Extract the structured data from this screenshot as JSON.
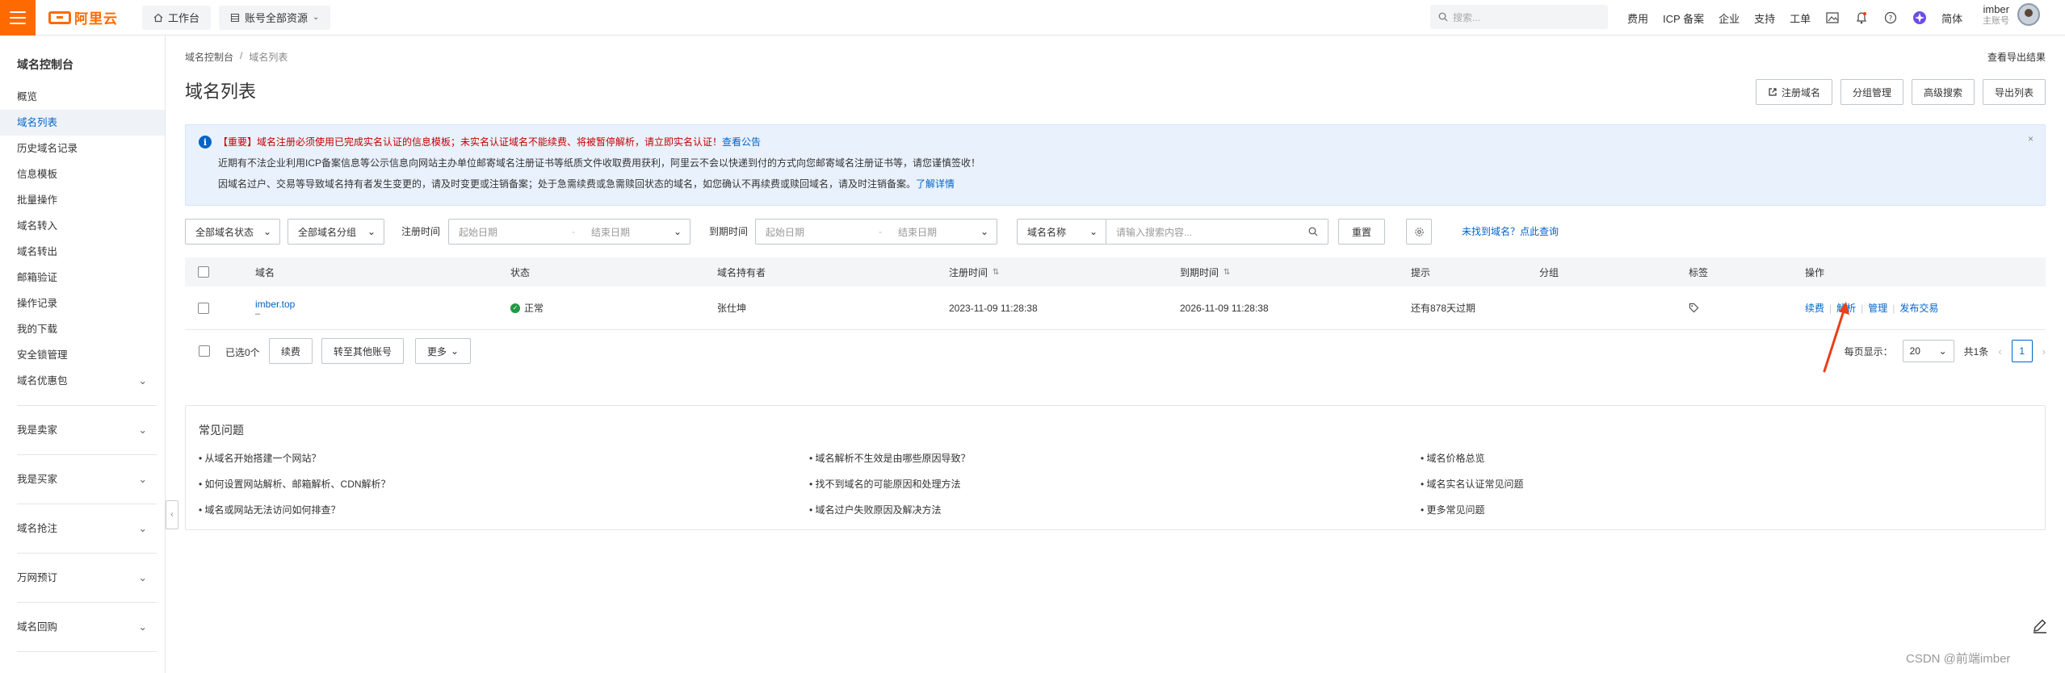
{
  "topbar": {
    "logo_text": "阿里云",
    "workbench": "工作台",
    "resources": "账号全部资源",
    "search_placeholder": "搜索...",
    "links": [
      "费用",
      "ICP 备案",
      "企业",
      "支持",
      "工单"
    ],
    "language": "简体",
    "user_name": "imber",
    "user_sub": "主账号"
  },
  "sidebar": {
    "title": "域名控制台",
    "items": [
      "概览",
      "域名列表",
      "历史域名记录",
      "信息模板",
      "批量操作",
      "域名转入",
      "域名转出",
      "邮箱验证",
      "操作记录",
      "我的下载",
      "安全锁管理"
    ],
    "active_index": 1,
    "groups": [
      "域名优惠包",
      "我是卖家",
      "我是买家",
      "域名抢注",
      "万网预订",
      "域名回购"
    ]
  },
  "breadcrumb": {
    "root": "域名控制台",
    "sep": "/",
    "current": "域名列表"
  },
  "export_results": "查看导出结果",
  "page_title": "域名列表",
  "header_buttons": [
    "注册域名",
    "分组管理",
    "高级搜索",
    "导出列表"
  ],
  "notice": {
    "line1": "【重要】域名注册必须使用已完成实名认证的信息模板；未实名认证域名不能续费、将被暂停解析，请立即实名认证！",
    "line1_link": "查看公告",
    "line2": "近期有不法企业利用ICP备案信息等公示信息向网站主办单位邮寄域名注册证书等纸质文件收取费用获利，阿里云不会以快递到付的方式向您邮寄域名注册证书等，请您谨慎签收！",
    "line3": "因域名过户、交易等导致域名持有者发生变更的，请及时变更或注销备案；处于急需续费或急需赎回状态的域名，如您确认不再续费或赎回域名，请及时注销备案。",
    "line3_link": "了解详情",
    "close": "×"
  },
  "filters": {
    "status": "全部域名状态",
    "group": "全部域名分组",
    "reg_label": "注册时间",
    "exp_label": "到期时间",
    "start_date": "起始日期",
    "dash": "-",
    "end_date": "结束日期",
    "search_type": "域名名称",
    "search_placeholder": "请输入搜索内容...",
    "reset": "重置",
    "not_found_link": "未找到域名？点此查询"
  },
  "table": {
    "columns": [
      "域名",
      "状态",
      "域名持有者",
      "注册时间",
      "到期时间",
      "提示",
      "分组",
      "标签",
      "操作"
    ],
    "rows": [
      {
        "domain": "imber.top",
        "domain_sub": "–",
        "status": "正常",
        "owner": "张仕坤",
        "reg_time": "2023-11-09 11:28:38",
        "exp_time": "2026-11-09 11:28:38",
        "hint": "还有878天过期",
        "group": "",
        "ops": [
          "续费",
          "解析",
          "管理",
          "发布交易"
        ]
      }
    ]
  },
  "footer": {
    "selected": "已选0个",
    "btn_renew": "续费",
    "btn_transfer": "转至其他账号",
    "btn_more": "更多",
    "page_size_label": "每页显示：",
    "page_size": "20",
    "total": "共1条",
    "current_page": "1"
  },
  "faq": {
    "title": "常见问题",
    "items": [
      "从域名开始搭建一个网站？",
      "域名解析不生效是由哪些原因导致？",
      "域名价格总览",
      "如何设置网站解析、邮箱解析、CDN解析？",
      "找不到域名的可能原因和处理方法",
      "域名实名认证常见问题",
      "域名或网站无法访问如何排查？",
      "域名过户失败原因及解决方法",
      "更多常见问题"
    ]
  },
  "watermark": "CSDN @前端imber",
  "colors": {
    "brand": "#ff6a00",
    "link": "#0064c8",
    "notice_bg": "#e9f1fc",
    "ok": "#1e9a44",
    "annotation": "#e8401c"
  }
}
